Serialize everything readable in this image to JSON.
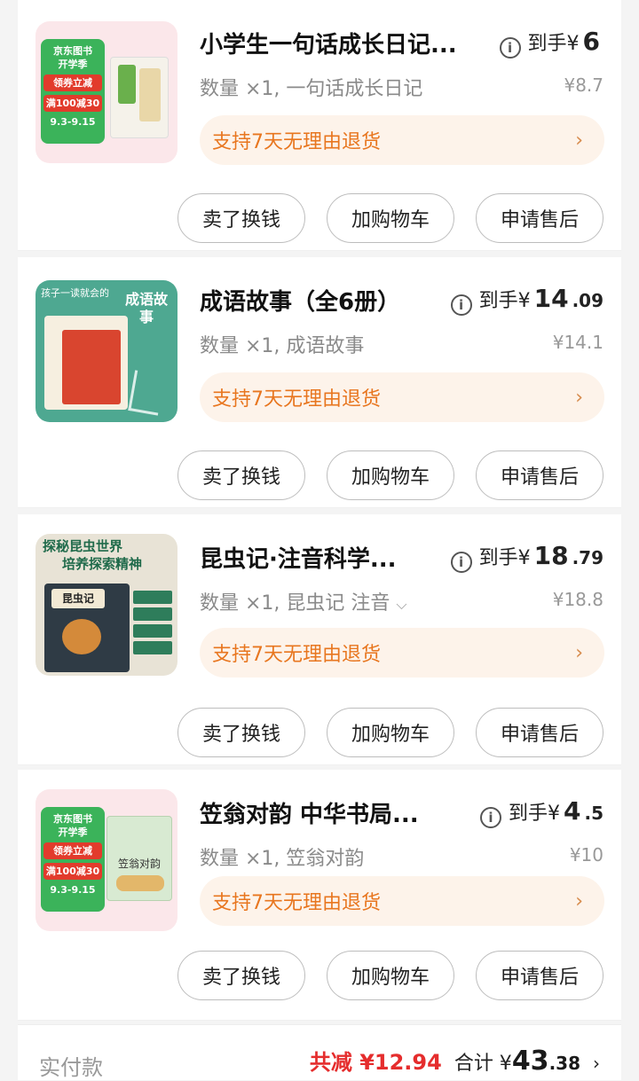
{
  "items": [
    {
      "title": "小学生一句话成长日记...",
      "price_label": "到手¥",
      "price_int": "6",
      "price_dec": "",
      "sub": "数量 ×1, 一句话成长日记",
      "orig": "¥8.7",
      "return_text": "支持7天无理由退货",
      "thumb_text": [
        "京东图书",
        "开学季",
        "领券立减",
        "满100减30",
        "9.3-9.15"
      ]
    },
    {
      "title": "成语故事（全6册）",
      "price_label": "到手¥",
      "price_int": "14",
      "price_dec": ".09",
      "sub": "数量 ×1, 成语故事",
      "orig": "¥14.1",
      "return_text": "支持7天无理由退货",
      "thumb_text": [
        "孩子一读就会的",
        "成语故事"
      ]
    },
    {
      "title": "昆虫记·注音科学...",
      "price_label": "到手¥",
      "price_int": "18",
      "price_dec": ".79",
      "sub": "数量 ×1, 昆虫记 注音",
      "orig": "¥18.8",
      "return_text": "支持7天无理由退货",
      "thumb_text": [
        "探秘昆虫世界",
        "培养探索精神",
        "昆虫记"
      ]
    },
    {
      "title": "笠翁对韵 中华书局...",
      "price_label": "到手¥",
      "price_int": "4",
      "price_dec": ".5",
      "sub": "数量 ×1, 笠翁对韵",
      "orig": "¥10",
      "return_text": "支持7天无理由退货",
      "thumb_text": [
        "京东图书",
        "开学季",
        "领券立减",
        "满100减30",
        "9.3-9.15",
        "笠翁对韵"
      ]
    }
  ],
  "buttons": {
    "sell": "卖了换钱",
    "cart": "加购物车",
    "after_sale": "申请售后"
  },
  "icons": {
    "info": "i",
    "chevron": "›"
  },
  "footer": {
    "label": "实付款",
    "saved": "共减 ¥12.94",
    "total_label": "合计 ¥",
    "total_int": "43",
    "total_dec": ".38",
    "chevron": "›"
  },
  "colors": {
    "accent_orange": "#e8761f",
    "return_bg": "#fdf3ea",
    "discount_red": "#e52d2d"
  }
}
